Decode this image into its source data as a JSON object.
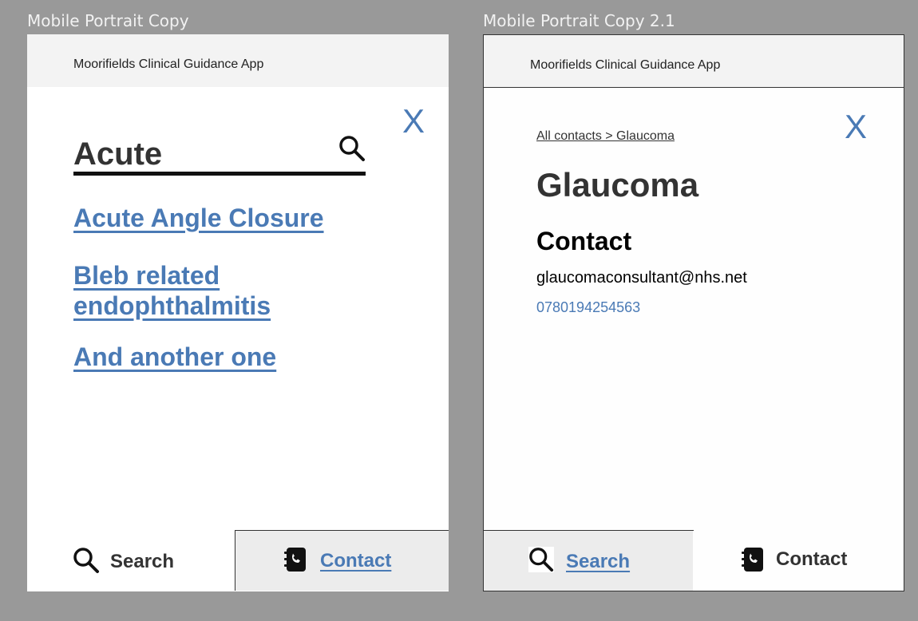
{
  "frames": [
    {
      "label": "Mobile Portrait Copy",
      "app_title": "Moorifields Clinical Guidance App",
      "close_label": "X",
      "search": {
        "value": "Acute"
      },
      "results": [
        {
          "label": "Acute Angle Closure"
        },
        {
          "label": "Bleb related\nendophthalmitis"
        },
        {
          "label": "And another one"
        }
      ],
      "tabs": {
        "search": {
          "label": "Search",
          "icon": "search-icon",
          "active": true
        },
        "contact": {
          "label": "Contact",
          "icon": "contact-book-icon",
          "active": false
        }
      }
    },
    {
      "label": "Mobile Portrait Copy 2.1",
      "app_title": "Moorifields Clinical Guidance App",
      "close_label": "X",
      "breadcrumb": "All contacts > Glaucoma",
      "page_title": "Glaucoma",
      "section_heading": "Contact",
      "email": "glaucomaconsultant@nhs.net",
      "phone": "0780194254563",
      "tabs": {
        "search": {
          "label": "Search",
          "icon": "search-icon",
          "active": false
        },
        "contact": {
          "label": "Contact",
          "icon": "contact-book-icon",
          "active": true
        }
      }
    }
  ],
  "colors": {
    "canvas": "#999999",
    "link": "#4a7ab5",
    "header_bg": "#f3f3f3",
    "inactive_tab_bg": "#ececec"
  }
}
